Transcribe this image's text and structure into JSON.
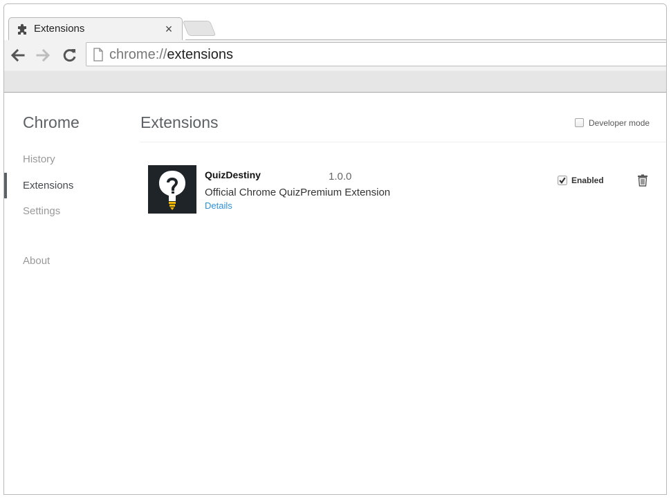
{
  "tab": {
    "title": "Extensions",
    "icon": "puzzle-piece-icon",
    "close_glyph": "×"
  },
  "toolbar": {
    "back_icon": "arrow-left-icon",
    "forward_icon": "arrow-right-icon",
    "reload_icon": "reload-icon"
  },
  "omnibox": {
    "scheme": "chrome://",
    "path": "extensions",
    "page_icon": "page-icon"
  },
  "sidebar": {
    "title": "Chrome",
    "items": [
      {
        "label": "History",
        "selected": false
      },
      {
        "label": "Extensions",
        "selected": true
      },
      {
        "label": "Settings",
        "selected": false
      },
      {
        "label": "About",
        "selected": false
      }
    ]
  },
  "main": {
    "title": "Extensions",
    "developer_mode": {
      "label": "Developer mode",
      "checked": false
    }
  },
  "extension": {
    "name": "QuizDestiny",
    "version": "1.0.0",
    "description": "Official Chrome QuizPremium Extension",
    "details_label": "Details",
    "enabled": {
      "label": "Enabled",
      "checked": true
    },
    "trash_icon": "trash-icon",
    "icon": "question-bulb-icon"
  },
  "colors": {
    "link": "#2d8fd5",
    "sidebar_marker": "#5c6166",
    "icon_bg": "#1f2429",
    "bulb_base": "#f5b800"
  }
}
